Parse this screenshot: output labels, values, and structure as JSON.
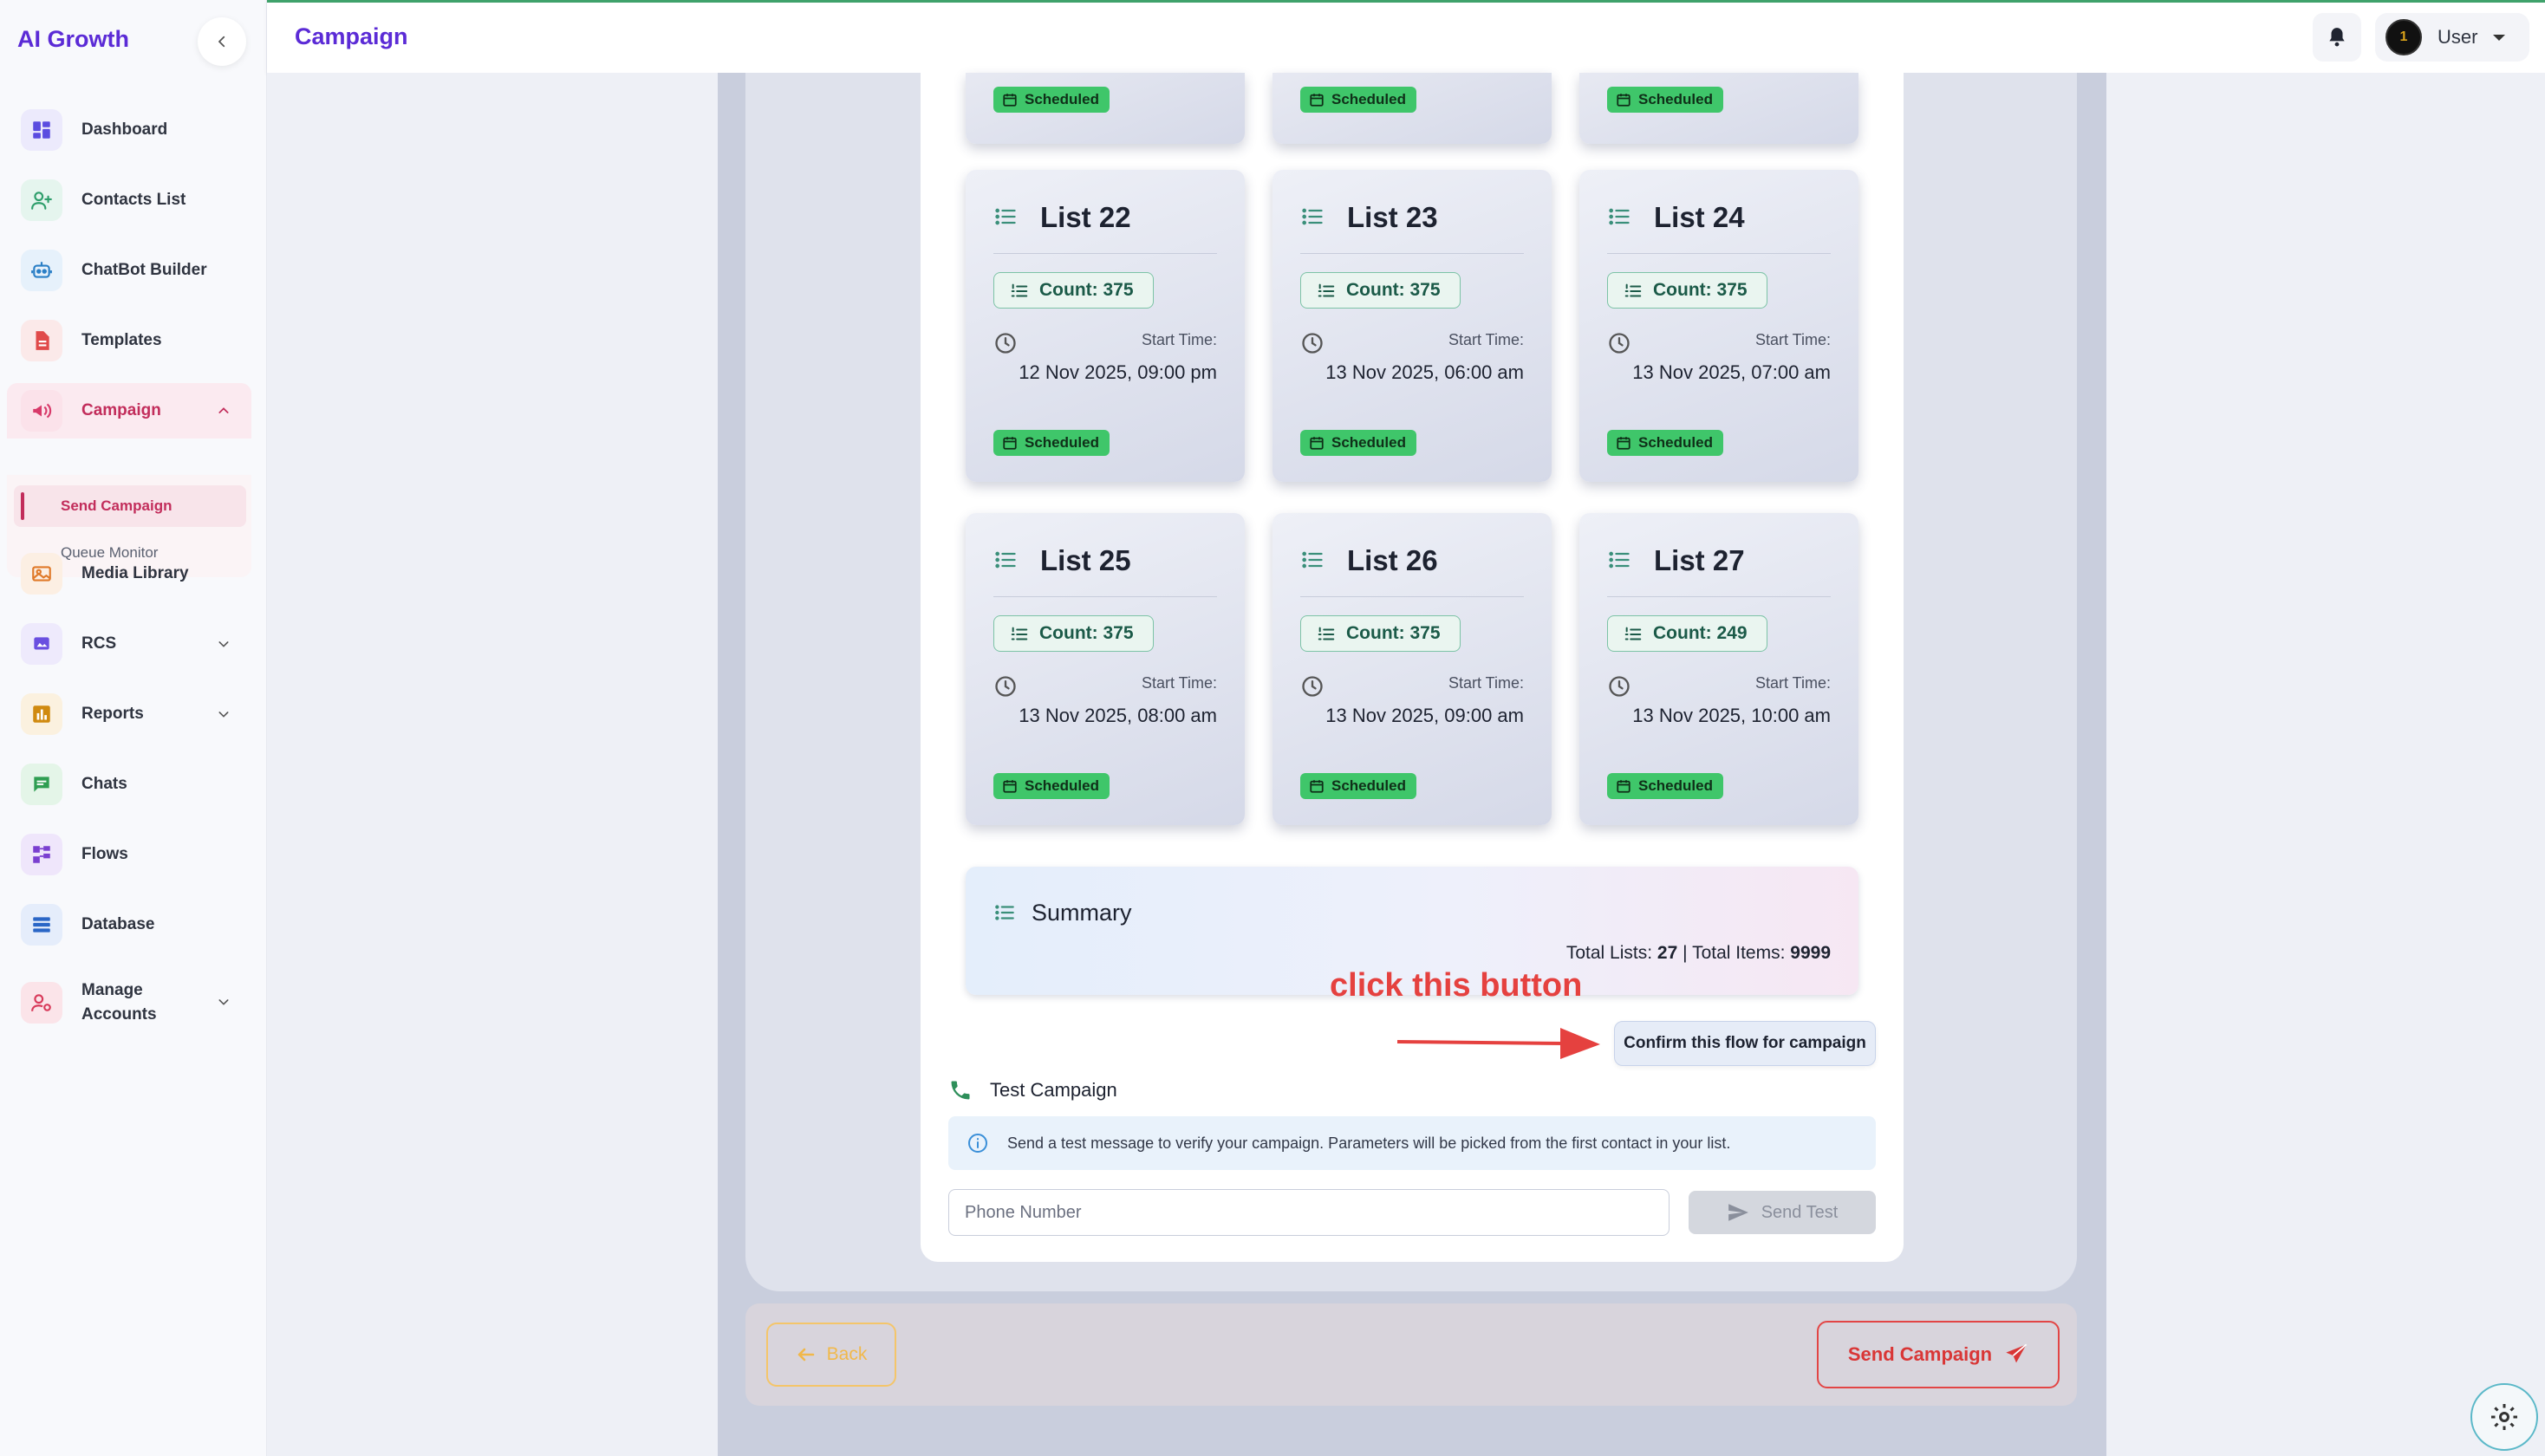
{
  "app": {
    "brand": "AI Growth"
  },
  "header": {
    "title": "Campaign",
    "user_name": "User",
    "avatar_letter": "1"
  },
  "sidebar": {
    "items": [
      {
        "label": "Dashboard",
        "icon": "dashboard-icon",
        "color": "#5b4ce0",
        "bg": "#eceafc"
      },
      {
        "label": "Contacts List",
        "icon": "contacts-icon",
        "color": "#2e9e6b",
        "bg": "#e5f5ee"
      },
      {
        "label": "ChatBot Builder",
        "icon": "robot-icon",
        "color": "#2a7fc6",
        "bg": "#e6f1fb"
      },
      {
        "label": "Templates",
        "icon": "document-icon",
        "color": "#e04a4a",
        "bg": "#fbe9e9"
      },
      {
        "label": "Campaign",
        "icon": "megaphone-icon",
        "color": "#d83a6a",
        "bg": "#fbe2ea"
      },
      {
        "label": "Media Library",
        "icon": "image-icon",
        "color": "#e07a2a",
        "bg": "#fcefe3"
      },
      {
        "label": "RCS",
        "icon": "rcs-icon",
        "color": "#6a4fe0",
        "bg": "#eeeafc"
      },
      {
        "label": "Reports",
        "icon": "bar-chart-icon",
        "color": "#d08a10",
        "bg": "#fbf1df"
      },
      {
        "label": "Chats",
        "icon": "chat-icon",
        "color": "#2f9e52",
        "bg": "#e4f5e8"
      },
      {
        "label": "Flows",
        "icon": "flows-icon",
        "color": "#7a3fd0",
        "bg": "#efe6fb"
      },
      {
        "label": "Database",
        "icon": "database-icon",
        "color": "#2a66c6",
        "bg": "#e5edfb"
      },
      {
        "label": "Manage",
        "label2": "Accounts",
        "icon": "user-gear-icon",
        "color": "#d83a5a",
        "bg": "#fbe4e9"
      }
    ],
    "campaign_sub": {
      "send": "Send Campaign",
      "queue": "Queue Monitor"
    }
  },
  "lists": [
    {
      "title": "List 22",
      "count": "Count: 375",
      "start_label": "Start Time:",
      "start_time": "12 Nov 2025, 09:00 pm",
      "status": "Scheduled"
    },
    {
      "title": "List 23",
      "count": "Count: 375",
      "start_label": "Start Time:",
      "start_time": "13 Nov 2025, 06:00 am",
      "status": "Scheduled"
    },
    {
      "title": "List 24",
      "count": "Count: 375",
      "start_label": "Start Time:",
      "start_time": "13 Nov 2025, 07:00 am",
      "status": "Scheduled"
    },
    {
      "title": "List 25",
      "count": "Count: 375",
      "start_label": "Start Time:",
      "start_time": "13 Nov 2025, 08:00 am",
      "status": "Scheduled"
    },
    {
      "title": "List 26",
      "count": "Count: 375",
      "start_label": "Start Time:",
      "start_time": "13 Nov 2025, 09:00 am",
      "status": "Scheduled"
    },
    {
      "title": "List 27",
      "count": "Count: 249",
      "start_label": "Start Time:",
      "start_time": "13 Nov 2025, 10:00 am",
      "status": "Scheduled"
    }
  ],
  "stub_status": "Scheduled",
  "summary": {
    "title": "Summary",
    "total_lists_label": "Total Lists:",
    "total_lists": "27",
    "separator": "|",
    "total_items_label": "Total Items:",
    "total_items": "9999"
  },
  "annotation": {
    "text": "click this button",
    "color": "#e5413f"
  },
  "confirm_button": "Confirm this flow for campaign",
  "test_campaign": {
    "title": "Test Campaign",
    "info": "Send a test message to verify your campaign. Parameters will be picked from the first contact in your list.",
    "phone_placeholder": "Phone Number",
    "send_label": "Send Test"
  },
  "footer": {
    "back_label": "Back",
    "send_label": "Send Campaign"
  }
}
